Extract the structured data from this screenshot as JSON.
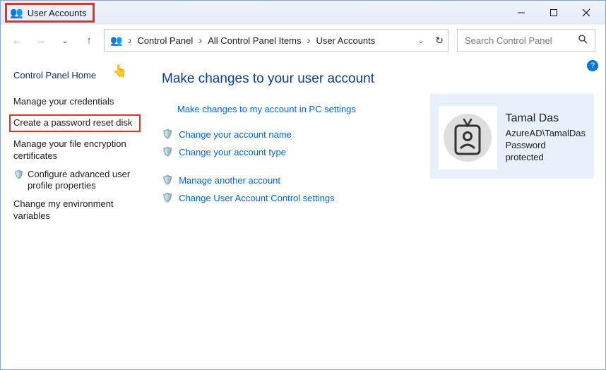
{
  "titlebar": {
    "title": "User Accounts"
  },
  "nav": {
    "crumbs": [
      "Control Panel",
      "All Control Panel Items",
      "User Accounts"
    ]
  },
  "search": {
    "placeholder": "Search Control Panel"
  },
  "sidebar": {
    "home": "Control Panel Home",
    "items": [
      {
        "label": "Manage your credentials",
        "shield": false,
        "highlight": false
      },
      {
        "label": "Create a password reset disk",
        "shield": false,
        "highlight": true
      },
      {
        "label": "Manage your file encryption certificates",
        "shield": false,
        "highlight": false
      },
      {
        "label": "Configure advanced user profile properties",
        "shield": true,
        "highlight": false
      },
      {
        "label": "Change my environment variables",
        "shield": false,
        "highlight": false
      }
    ]
  },
  "main": {
    "heading": "Make changes to your user account",
    "pc_settings_link": "Make changes to my account in PC settings",
    "actions": [
      {
        "label": "Change your account name",
        "shield": true
      },
      {
        "label": "Change your account type",
        "shield": true
      }
    ],
    "actions2": [
      {
        "label": "Manage another account",
        "shield": true
      },
      {
        "label": "Change User Account Control settings",
        "shield": true
      }
    ]
  },
  "user": {
    "name": "Tamal Das",
    "domain": "AzureAD\\TamalDas",
    "status": "Password protected"
  }
}
